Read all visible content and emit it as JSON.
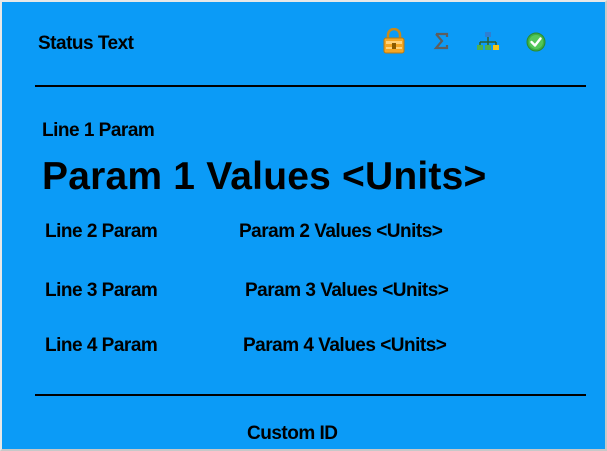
{
  "header": {
    "status_text": "Status Text",
    "icons": [
      "lock-icon",
      "sigma-icon",
      "network-icon",
      "check-icon"
    ]
  },
  "line1": {
    "label": "Line 1 Param",
    "value": "Param 1 Values <Units>"
  },
  "line2": {
    "label": "Line 2 Param",
    "value": "Param 2 Values <Units>"
  },
  "line3": {
    "label": "Line 3 Param",
    "value": "Param 3 Values <Units>"
  },
  "line4": {
    "label": "Line 4 Param",
    "value": "Param 4 Values <Units>"
  },
  "footer": {
    "custom_id": "Custom ID"
  },
  "colors": {
    "background": "#0b9bf7",
    "text": "#000000",
    "lock": "#f5a623",
    "sigma": "#6b6b6b",
    "network": "#3a8a3a",
    "check": "#3cb043"
  }
}
